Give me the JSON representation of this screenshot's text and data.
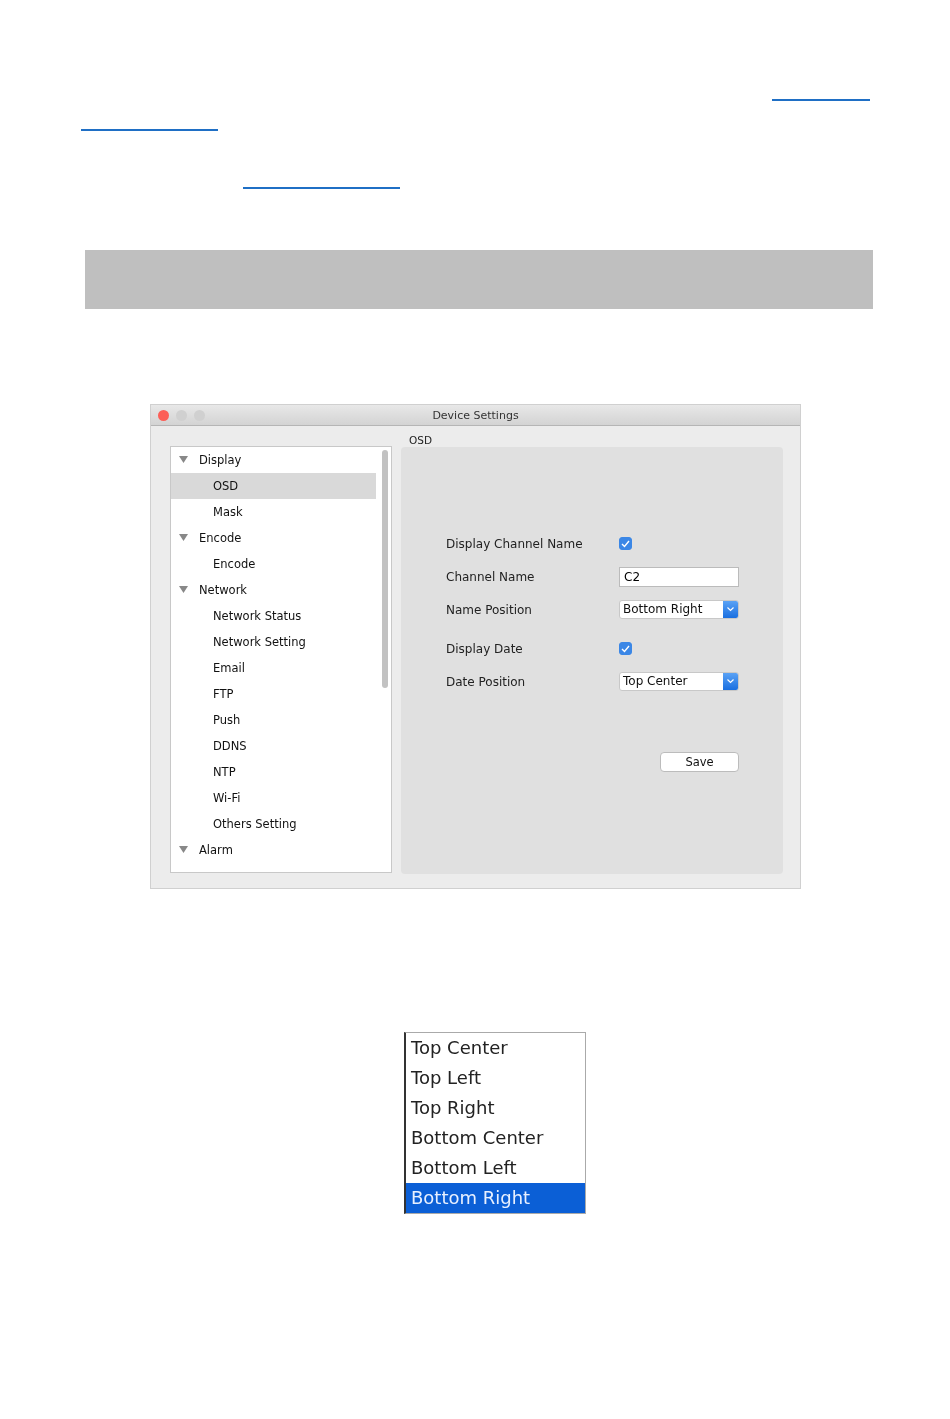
{
  "window": {
    "title": "Device Settings",
    "controls": [
      {
        "kind": "close"
      },
      {
        "kind": "minimize"
      },
      {
        "kind": "zoom"
      }
    ]
  },
  "tree": {
    "items": [
      {
        "label": "Display",
        "expanded": true,
        "selected": false,
        "children": [
          {
            "label": "OSD",
            "selected": true
          },
          {
            "label": "Mask",
            "selected": false
          }
        ]
      },
      {
        "label": "Encode",
        "expanded": true,
        "selected": false,
        "children": [
          {
            "label": "Encode",
            "selected": false
          }
        ]
      },
      {
        "label": "Network",
        "expanded": true,
        "selected": false,
        "children": [
          {
            "label": "Network Status",
            "selected": false
          },
          {
            "label": "Network Setting",
            "selected": false
          },
          {
            "label": "Email",
            "selected": false
          },
          {
            "label": "FTP",
            "selected": false
          },
          {
            "label": "Push",
            "selected": false
          },
          {
            "label": "DDNS",
            "selected": false
          },
          {
            "label": "NTP",
            "selected": false
          },
          {
            "label": "Wi-Fi",
            "selected": false
          },
          {
            "label": "Others Setting",
            "selected": false
          }
        ]
      },
      {
        "label": "Alarm",
        "expanded": true,
        "selected": false
      }
    ]
  },
  "panel": {
    "title": "OSD",
    "fields": [
      {
        "kind": "checkbox",
        "label": "Display Channel Name",
        "checked": true
      },
      {
        "kind": "text",
        "label": "Channel Name",
        "value": "C2"
      },
      {
        "kind": "select",
        "label": "Name Position",
        "value": "Bottom Right"
      },
      {
        "kind": "checkbox",
        "label": "Display Date",
        "checked": true
      },
      {
        "kind": "select",
        "label": "Date Position",
        "value": "Top Center"
      }
    ],
    "save_button": "Save"
  },
  "dropdown": {
    "options": [
      {
        "label": "Top Center",
        "selected": false
      },
      {
        "label": "Top Left",
        "selected": false
      },
      {
        "label": "Top Right",
        "selected": false
      },
      {
        "label": "Bottom Center",
        "selected": false
      },
      {
        "label": "Bottom Left",
        "selected": false
      },
      {
        "label": "Bottom Right",
        "selected": true
      }
    ]
  }
}
